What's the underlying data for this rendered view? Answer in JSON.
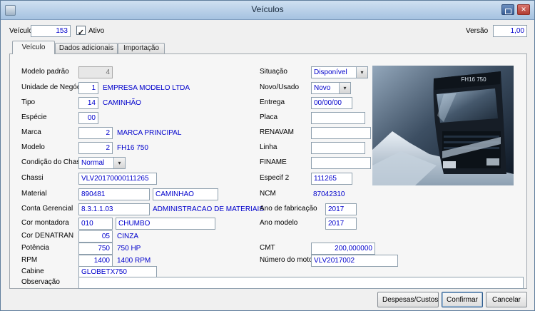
{
  "window": {
    "title": "Veículos"
  },
  "icons": {
    "close": "✕",
    "check": "✓",
    "chevron_down": "▾"
  },
  "header": {
    "vehicle_label": "Veículo",
    "vehicle_value": "153",
    "active_label": "Ativo",
    "version_label": "Versão",
    "version_value": "1,00"
  },
  "tabs": {
    "veiculo": "Veículo",
    "dados": "Dados adicionais",
    "importacao": "Importação"
  },
  "form": {
    "modelo_padrao": {
      "label": "Modelo padrão",
      "value": "4"
    },
    "unidade": {
      "label": "Unidade de Negócio",
      "code": "1",
      "desc": "EMPRESA MODELO LTDA"
    },
    "tipo": {
      "label": "Tipo",
      "code": "14",
      "desc": "CAMINHÃO"
    },
    "especie": {
      "label": "Espécie",
      "code": "00"
    },
    "marca": {
      "label": "Marca",
      "code": "2",
      "desc": "MARCA PRINCIPAL"
    },
    "modelo": {
      "label": "Modelo",
      "code": "2",
      "desc": "FH16 750"
    },
    "condicao_chassi": {
      "label": "Condição do Chassi",
      "value": "Normal"
    },
    "chassi": {
      "label": "Chassi",
      "value": "VLV20170000111265"
    },
    "material": {
      "label": "Material",
      "code": "890481",
      "desc": "CAMINHAO"
    },
    "conta_gerencial": {
      "label": "Conta Gerencial",
      "code": "8.3.1.1.03",
      "desc": "ADMINISTRACAO DE MATERIAIS"
    },
    "cor_montadora": {
      "label": "Cor montadora",
      "code": "010",
      "desc": "CHUMBO"
    },
    "cor_denatran": {
      "label": "Cor DENATRAN",
      "code": "05",
      "desc": "CINZA"
    },
    "potencia": {
      "label": "Potência",
      "code": "750",
      "desc": "750 HP"
    },
    "rpm": {
      "label": "RPM",
      "code": "1400",
      "desc": "1400 RPM"
    },
    "cabine": {
      "label": "Cabine",
      "value": "GLOBETX750"
    },
    "observacao": {
      "label": "Observação",
      "value": ""
    },
    "situacao": {
      "label": "Situação",
      "value": "Disponível"
    },
    "novo_usado": {
      "label": "Novo/Usado",
      "value": "Novo"
    },
    "entrega": {
      "label": "Entrega",
      "value": "00/00/00"
    },
    "placa": {
      "label": "Placa",
      "value": ""
    },
    "renavam": {
      "label": "RENAVAM",
      "value": ""
    },
    "linha": {
      "label": "Linha",
      "value": ""
    },
    "finame": {
      "label": "FINAME",
      "value": ""
    },
    "especif2": {
      "label": "Especif 2",
      "value": "111265"
    },
    "ncm": {
      "label": "NCM",
      "value": "87042310"
    },
    "ano_fabricacao": {
      "label": "Ano de fabricação",
      "value": "2017"
    },
    "ano_modelo": {
      "label": "Ano modelo",
      "value": "2017"
    },
    "cmt": {
      "label": "CMT",
      "value": "200,000000"
    },
    "numero_motor": {
      "label": "Número do motor",
      "value": "VLV2017002"
    }
  },
  "photo": {
    "badge": "FH16 750"
  },
  "footer": {
    "despesas": "Despesas/Custos",
    "confirmar": "Confirmar",
    "cancelar": "Cancelar"
  }
}
